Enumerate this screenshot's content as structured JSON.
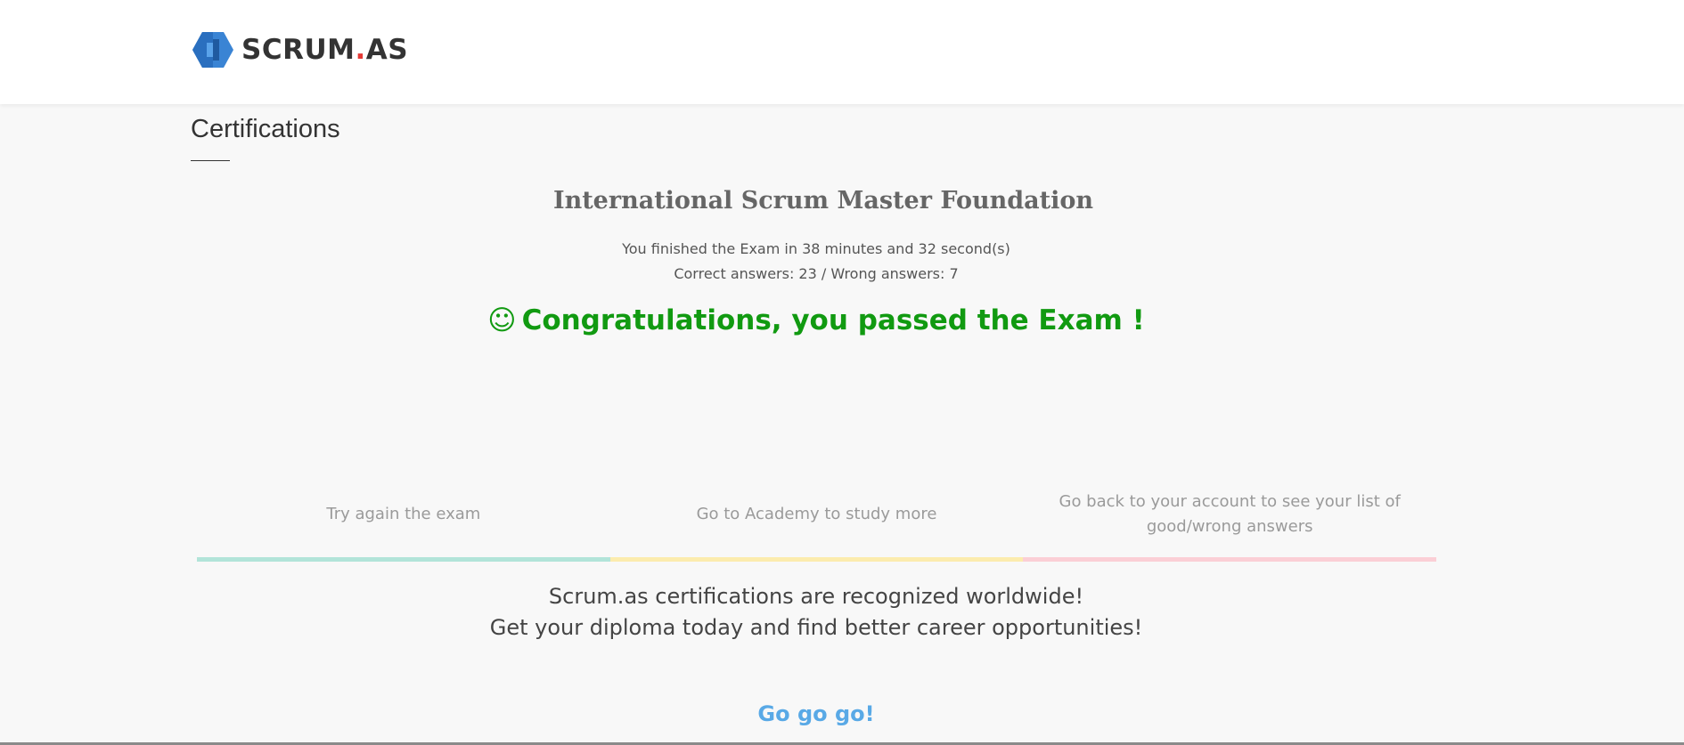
{
  "header": {
    "logo_text": "SCRUM",
    "logo_dot": ".",
    "logo_suffix": "AS"
  },
  "page": {
    "section_title": "Certifications"
  },
  "result": {
    "exam_name": "International Scrum Master Foundation",
    "finished_text": "You finished the Exam in 38 minutes and 32 second(s)",
    "answers_text": "Correct answers: 23 / Wrong answers: 7",
    "smile_glyph": "☺",
    "congrats_text": "Congratulations, you passed the Exam !",
    "congrats_color": "#119a11"
  },
  "options": [
    {
      "label": "Try again the exam",
      "bar_color": "#b2e4d9"
    },
    {
      "label": "Go to Academy to study more",
      "bar_color": "#fcecae"
    },
    {
      "label": "Go back to your account to see your list of good/wrong answers",
      "bar_color": "#fbcfd6"
    }
  ],
  "promo": {
    "line1": "Scrum.as certifications are recognized worldwide!",
    "line2": "Get your diploma today and find better career opportunities!",
    "cta": "Go go go!",
    "cta_color": "#59a9e6"
  }
}
